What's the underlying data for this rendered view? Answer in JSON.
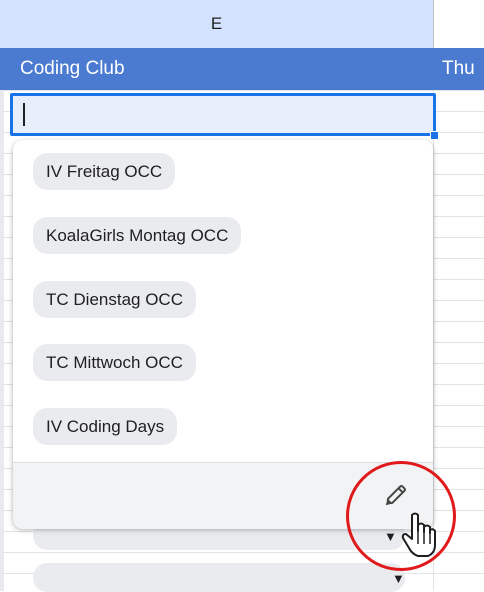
{
  "sheet": {
    "column_header": "E",
    "header_row": {
      "cell_label": "Coding Club",
      "next_cell_label": "Thu"
    },
    "edit_cell_value": ""
  },
  "dropdown": {
    "options": [
      "IV Freitag OCC",
      "KoalaGirls Montag OCC",
      "TC Dienstag OCC",
      "TC Mittwoch OCC",
      "IV Coding Days"
    ],
    "edit_icon": "pencil-icon"
  },
  "colors": {
    "header_row": "#4a7bd0",
    "selected_column": "#d3e3fd",
    "focus_border": "#1a73e8",
    "chip_bg": "#e9ebee",
    "annotation": "#e0191b"
  },
  "cursor": "hand-pointer-icon"
}
